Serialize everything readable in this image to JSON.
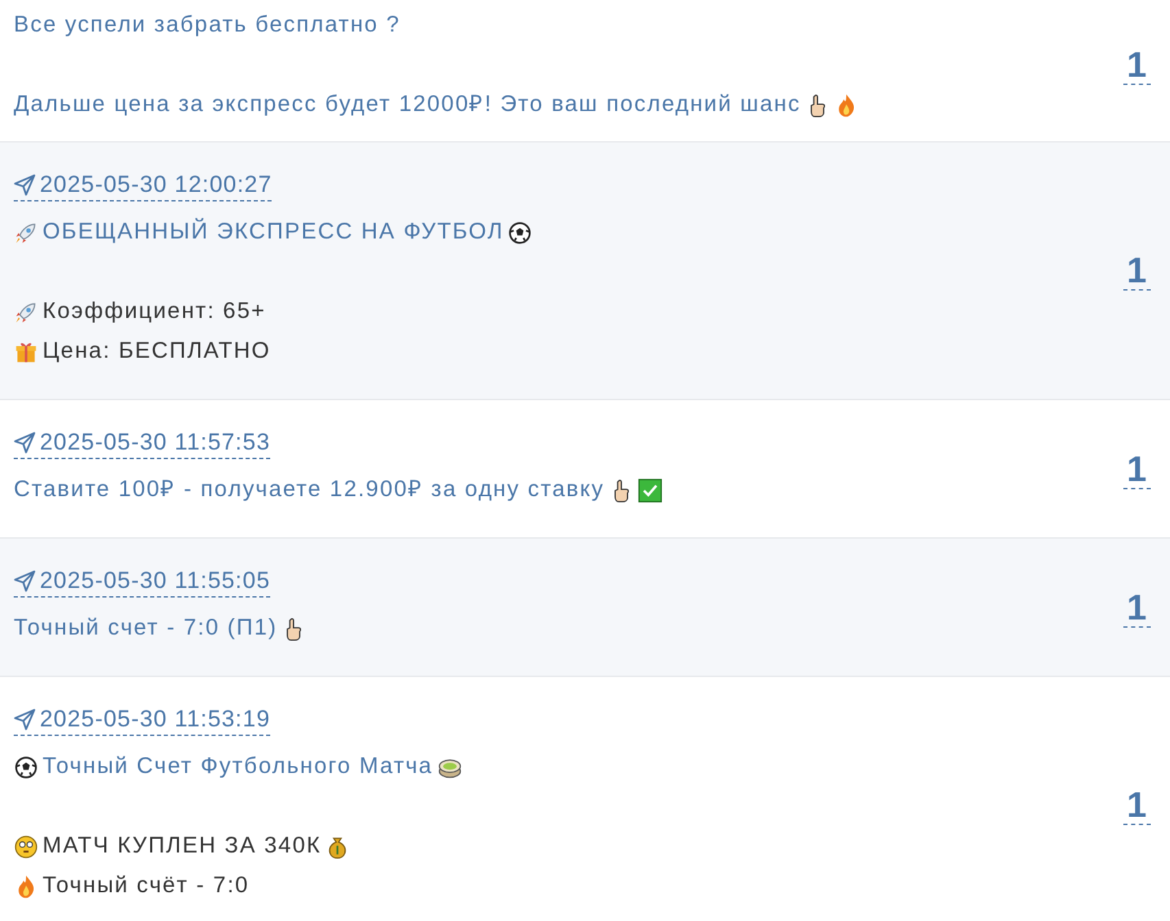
{
  "posts": [
    {
      "lines": [
        {
          "kind": "link",
          "parts": [
            {
              "kind": "text",
              "text": "Все успели забрать бесплатно ?"
            }
          ]
        },
        {
          "kind": "gap"
        },
        {
          "kind": "link",
          "parts": [
            {
              "kind": "text",
              "text": "Дальше цена за экспресс будет 12000₽! Это ваш последний шанс"
            },
            {
              "kind": "finger"
            },
            {
              "kind": "fire"
            }
          ]
        }
      ],
      "count": "1"
    },
    {
      "timestamp": "2025-05-30 12:00:27",
      "lines": [
        {
          "kind": "link",
          "parts": [
            {
              "kind": "rocket"
            },
            {
              "kind": "text",
              "text": "ОБЕЩАННЫЙ ЭКСПРЕСС НА ФУТБОЛ"
            },
            {
              "kind": "ball"
            }
          ]
        },
        {
          "kind": "gap"
        },
        {
          "kind": "plain",
          "parts": [
            {
              "kind": "rocket"
            },
            {
              "kind": "text",
              "text": "Коэффициент: 65+"
            }
          ]
        },
        {
          "kind": "plain",
          "parts": [
            {
              "kind": "gift"
            },
            {
              "kind": "text",
              "text": "Цена: БЕСПЛАТНО"
            }
          ]
        }
      ],
      "count": "1"
    },
    {
      "timestamp": "2025-05-30 11:57:53",
      "lines": [
        {
          "kind": "link",
          "parts": [
            {
              "kind": "text",
              "text": "Ставите 100₽ - получаете 12.900₽ за одну ставку"
            },
            {
              "kind": "finger"
            },
            {
              "kind": "check"
            }
          ]
        }
      ],
      "count": "1"
    },
    {
      "timestamp": "2025-05-30 11:55:05",
      "lines": [
        {
          "kind": "link",
          "parts": [
            {
              "kind": "text",
              "text": "Точный счет - 7:0 (П1)"
            },
            {
              "kind": "hand"
            }
          ]
        }
      ],
      "count": "1"
    },
    {
      "timestamp": "2025-05-30 11:53:19",
      "lines": [
        {
          "kind": "link",
          "parts": [
            {
              "kind": "ball"
            },
            {
              "kind": "text",
              "text": "Точный Счет Футбольного Матча"
            },
            {
              "kind": "stadium"
            }
          ]
        },
        {
          "kind": "gap"
        },
        {
          "kind": "plain",
          "parts": [
            {
              "kind": "face"
            },
            {
              "kind": "text",
              "text": "МАТЧ КУПЛЕН ЗА 340К"
            },
            {
              "kind": "moneybag"
            }
          ]
        },
        {
          "kind": "plain",
          "parts": [
            {
              "kind": "fire"
            },
            {
              "kind": "text",
              "text": "Точный счёт - 7:0"
            }
          ]
        }
      ],
      "count": "1"
    }
  ]
}
